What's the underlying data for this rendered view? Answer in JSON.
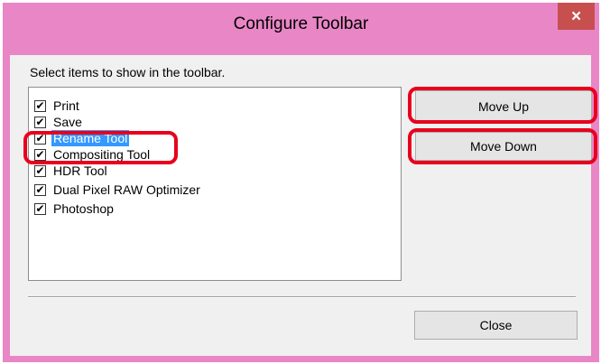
{
  "window": {
    "title": "Configure Toolbar",
    "close_glyph": "×"
  },
  "dialog": {
    "instruction": "Select items to show in the toolbar.",
    "items": [
      {
        "label": "Print",
        "checked": true
      },
      {
        "label": "Save",
        "checked": true
      },
      {
        "label": "Rename Tool",
        "checked": true,
        "selected": true
      },
      {
        "label": "Compositing Tool",
        "checked": true
      },
      {
        "label": "HDR Tool",
        "checked": true
      },
      {
        "label": "Dual Pixel RAW Optimizer",
        "checked": true
      },
      {
        "label": "Photoshop",
        "checked": true
      }
    ],
    "check_glyph": "✔",
    "move_up_label": "Move Up",
    "move_down_label": "Move Down",
    "close_label": "Close"
  },
  "colors": {
    "frame": "#e986c6",
    "close_button": "#c7504f",
    "selection": "#3399ff",
    "highlight": "#e8001d"
  }
}
